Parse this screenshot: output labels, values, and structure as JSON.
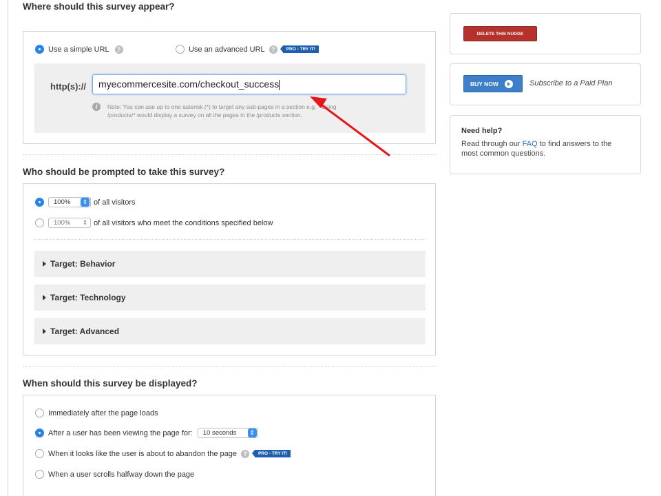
{
  "section_url": {
    "title": "Where should this survey appear?",
    "option_simple": "Use a simple URL",
    "option_advanced": "Use an advanced URL",
    "pro_badge": "PRO - TRY IT!",
    "url_prefix": "http(s)://",
    "url_value": "myecommercesite.com/checkout_success",
    "note_line1": "Note: You can use up to one asterisk (*) to target any sub-pages in a section e.g. - Using",
    "note_line2": "/products/* would display a survey on all the pages in the /products section."
  },
  "section_visitors": {
    "title": "Who should be prompted to take this survey?",
    "option_all": {
      "percent": "100%",
      "label": "of all visitors"
    },
    "option_conditions": {
      "percent": "100%",
      "label": "of all visitors who meet the conditions specified below"
    },
    "targets": [
      "Target: Behavior",
      "Target: Technology",
      "Target: Advanced"
    ]
  },
  "section_display": {
    "title": "When should this survey be displayed?",
    "option_immediately": "Immediately after the page loads",
    "option_after_viewing": "After a user has been viewing the page for:",
    "delay_value": "10 seconds",
    "option_abandon": "When it looks like the user is about to abandon the page",
    "pro_badge": "PRO - TRY IT!",
    "option_scroll": "When a user scrolls halfway down the page"
  },
  "sidebar": {
    "delete_button": "DELETE THIS NUDGE",
    "buy_button": "BUY NOW",
    "subscribe_text": "Subscribe to a Paid Plan",
    "help_title": "Need help?",
    "help_prefix": "Read through our ",
    "help_link": "FAQ",
    "help_suffix_line1": " to find answers to the",
    "help_line2": "most common questions."
  },
  "colors": {
    "accent": "#2b83e6",
    "pro_badge": "#1e5fb0",
    "delete_button": "#b5322c",
    "buy_button": "#3d7fc9",
    "annotation_arrow": "#e8161b"
  }
}
